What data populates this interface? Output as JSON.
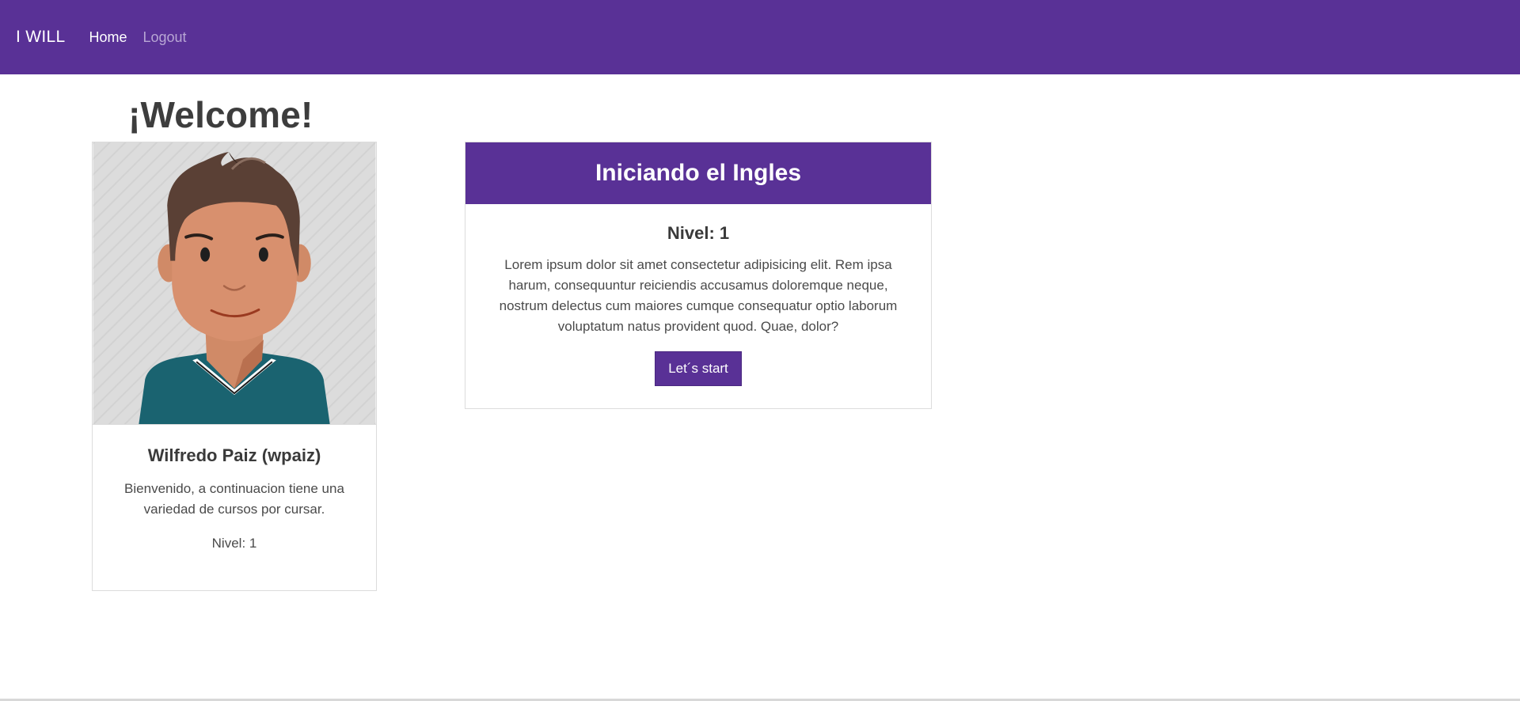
{
  "navbar": {
    "brand": "I WILL",
    "links": [
      {
        "label": "Home",
        "active": true
      },
      {
        "label": "Logout",
        "active": false
      }
    ],
    "color": "#593196"
  },
  "page": {
    "welcome": "¡Welcome!"
  },
  "profile": {
    "name": "Wilfredo Paiz (wpaiz)",
    "message": "Bienvenido, a continuacion tiene una variedad de cursos por cursar.",
    "level": "Nivel: 1",
    "avatar_icon": "male-avatar-illustration"
  },
  "course": {
    "title": "Iniciando el Ingles",
    "level": "Nivel: 1",
    "description": "Lorem ipsum dolor sit amet consectetur adipisicing elit. Rem ipsa harum, consequuntur reiciendis accusamus doloremque neque, nostrum delectus cum maiores cumque consequatur optio laborum voluptatum natus provident quod. Quae, dolor?",
    "button_label": "Let´s start"
  }
}
